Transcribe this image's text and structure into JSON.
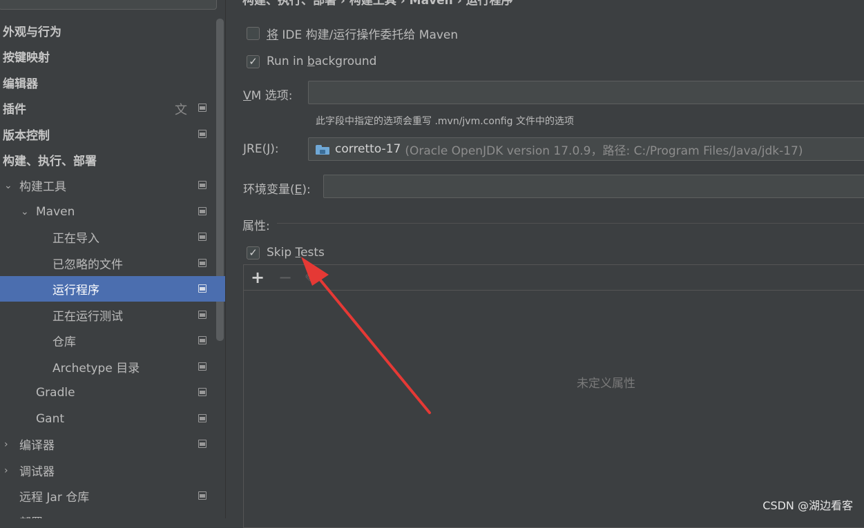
{
  "sidebar": {
    "items": [
      {
        "label": "外观与行为"
      },
      {
        "label": "按键映射"
      },
      {
        "label": "编辑器"
      },
      {
        "label": "插件"
      },
      {
        "label": "版本控制"
      },
      {
        "label": "构建、执行、部署"
      },
      {
        "label": "构建工具"
      },
      {
        "label": "Maven"
      },
      {
        "label": "正在导入"
      },
      {
        "label": "已忽略的文件"
      },
      {
        "label": "运行程序"
      },
      {
        "label": "正在运行测试"
      },
      {
        "label": "仓库"
      },
      {
        "label": "Archetype 目录"
      },
      {
        "label": "Gradle"
      },
      {
        "label": "Gant"
      },
      {
        "label": "编译器"
      },
      {
        "label": "调试器"
      },
      {
        "label": "远程 Jar 仓库"
      },
      {
        "label": "部署"
      }
    ]
  },
  "main": {
    "breadcrumb": "构建、执行、部署  ›  构建工具  ›  Maven  ›  运行程序",
    "delegate": {
      "prefix": "将",
      "rest": " IDE 构建/运行操作委托给 Maven",
      "checked": false
    },
    "background": {
      "pre": "Run in ",
      "mnemonic": "b",
      "post": "ackground",
      "checked": true
    },
    "vm": {
      "mnemonic": "V",
      "rest": "M 选项:"
    },
    "hint": "此字段中指定的选项会重写 .mvn/jvm.config 文件中的选项",
    "jre": {
      "pre": "JRE(",
      "mnemonic": "J",
      "post": "):",
      "name": "corretto-17",
      "desc": "(Oracle OpenJDK version 17.0.9，路径: C:/Program Files/Java/jdk-17)"
    },
    "env": {
      "pre": "环境变量(",
      "mnemonic": "E",
      "post": "):"
    },
    "properties_label": "属性:",
    "skip_tests": {
      "pre": "Skip ",
      "mnemonic": "T",
      "post": "ests",
      "checked": true
    },
    "toolbar": {
      "add": "+",
      "remove": "−",
      "edit": "✎"
    },
    "empty_text": "未定义属性"
  },
  "checkmark": "✓",
  "watermark": "CSDN @湖边看客",
  "colors": {
    "selection": "#4b6eaf",
    "annotation_arrow": "#e53935"
  }
}
